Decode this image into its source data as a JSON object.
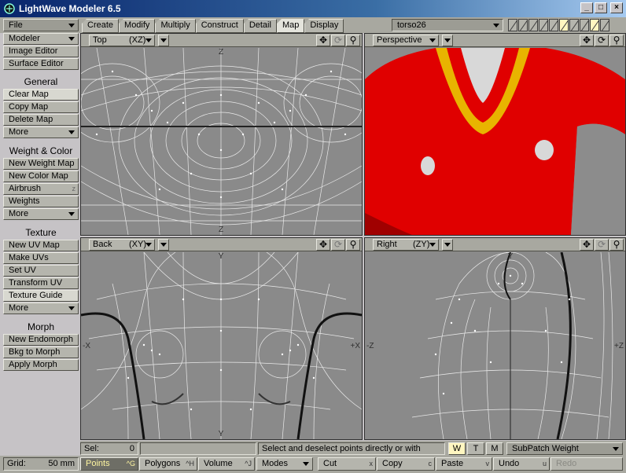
{
  "window": {
    "title": "LightWave Modeler 6.5",
    "min": "_",
    "max": "□",
    "close": "×"
  },
  "menus": {
    "file": "File",
    "modeler": "Modeler"
  },
  "tabs": [
    "Create",
    "Modify",
    "Multiply",
    "Construct",
    "Detail",
    "Map",
    "Display"
  ],
  "active_tab": "Map",
  "object_select": "torso26",
  "sidebar": {
    "top_buttons": [
      "Image Editor",
      "Surface Editor"
    ],
    "groups": [
      {
        "heading": "General",
        "items": [
          {
            "label": "Clear Map",
            "key": ""
          },
          {
            "label": "Copy Map",
            "key": ""
          },
          {
            "label": "Delete Map",
            "key": ""
          },
          {
            "label": "More",
            "key": ""
          }
        ]
      },
      {
        "heading": "Weight & Color",
        "items": [
          {
            "label": "New Weight Map",
            "key": ""
          },
          {
            "label": "New Color Map",
            "key": ""
          },
          {
            "label": "Airbrush",
            "key": "z"
          },
          {
            "label": "Weights",
            "key": ""
          },
          {
            "label": "More",
            "key": ""
          }
        ]
      },
      {
        "heading": "Texture",
        "items": [
          {
            "label": "New UV Map",
            "key": ""
          },
          {
            "label": "Make UVs",
            "key": ""
          },
          {
            "label": "Set UV",
            "key": ""
          },
          {
            "label": "Transform UV",
            "key": ""
          },
          {
            "label": "Texture Guide",
            "key": ""
          },
          {
            "label": "More",
            "key": ""
          }
        ]
      },
      {
        "heading": "Morph",
        "items": [
          {
            "label": "New Endomorph",
            "key": ""
          },
          {
            "label": "Bkg to Morph",
            "key": ""
          },
          {
            "label": "Apply Morph",
            "key": ""
          }
        ]
      }
    ]
  },
  "viewports": {
    "top": {
      "name": "Top",
      "axis": "(XZ)",
      "labels": {
        "top": "Z",
        "bottom": "Z"
      }
    },
    "perspective": {
      "name": "Perspective",
      "axis": ""
    },
    "back": {
      "name": "Back",
      "axis": "(XY)",
      "labels": {
        "top": "Y",
        "bottom": "Y",
        "left": "-X",
        "right": "+X"
      }
    },
    "right": {
      "name": "Right",
      "axis": "(ZY)",
      "labels": {
        "top": "Y",
        "left": "-Z",
        "right": "+Z"
      }
    }
  },
  "status": {
    "sel_label": "Sel:",
    "sel_value": "0",
    "message": "Select and deselect points directly or with lasso.",
    "wtm": [
      "W",
      "T",
      "M"
    ],
    "vmap": "SubPatch Weight"
  },
  "bottom": {
    "grid_label": "Grid:",
    "grid_value": "50 mm",
    "modes": [
      {
        "label": "Points",
        "key": "^G"
      },
      {
        "label": "Polygons",
        "key": "^H"
      },
      {
        "label": "Volume",
        "key": "^J"
      }
    ],
    "modes_menu": "Modes",
    "actions": [
      {
        "label": "Cut",
        "key": "x"
      },
      {
        "label": "Copy",
        "key": "c"
      },
      {
        "label": "Paste",
        "key": "v"
      },
      {
        "label": "Undo",
        "key": "u"
      },
      {
        "label": "Redo",
        "key": ""
      }
    ]
  },
  "colors": {
    "shirt": "#e00000",
    "collar": "#e8b400",
    "selected_mode_text": "#fff6a0"
  }
}
